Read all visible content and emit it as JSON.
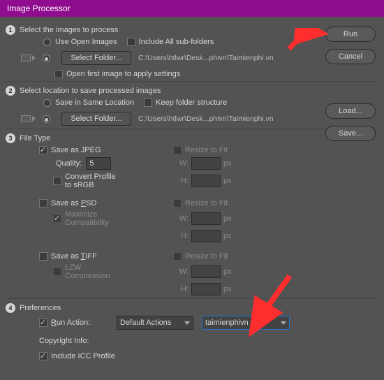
{
  "window": {
    "title": "Image Processor"
  },
  "buttons": {
    "run": "Run",
    "cancel": "Cancel",
    "load": "Load...",
    "save": "Save...",
    "select_folder": "Select Folder..."
  },
  "s1": {
    "num": "1",
    "title": "Select the images to process",
    "use_open": "Use Open Images",
    "include_sub": "Include All sub-folders",
    "path": "C:\\Users\\htlwr\\Desk...phivn\\Taimienphi.vn",
    "open_first": "Open first image to apply settings"
  },
  "s2": {
    "num": "2",
    "title": "Select location to save processed images",
    "same_loc": "Save in Same Location",
    "keep_folder": "Keep folder structure",
    "path": "C:\\Users\\htlwr\\Desk...phivn\\Taimienphi.vn"
  },
  "s3": {
    "num": "3",
    "title": "File Type",
    "save_jpeg": "Save as JPEG",
    "resize": "Resize to Fit",
    "quality": "Quality:",
    "quality_val": "5",
    "convert_srgb": "Convert Profile to sRGB",
    "save_psd": "Save as PSD",
    "maximize": "Maximize Compatibility",
    "save_tiff": "Save as TIFF",
    "lzw": "LZW Compression",
    "w": "W:",
    "h": "H:",
    "px": "px"
  },
  "s4": {
    "num": "4",
    "title": "Preferences",
    "run_action": "Run Action:",
    "set_sel": "Default Actions",
    "act_sel": "taimienphivn",
    "copyright": "Copyright Info:",
    "icc": "Include ICC Profile"
  }
}
